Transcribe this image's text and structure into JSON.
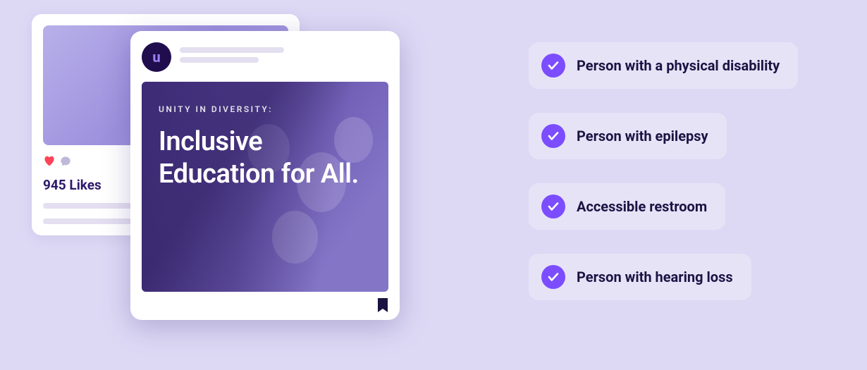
{
  "colors": {
    "background": "#ddd9f5",
    "chip_bg": "#e7e3f7",
    "accent": "#7b4dff",
    "text_dark": "#1a1443",
    "avatar_bg": "#1f0d4d",
    "heart": "#ff4458"
  },
  "back_card": {
    "likes_label": "945 Likes"
  },
  "front_card": {
    "avatar_letter": "u",
    "eyebrow": "UNITY IN DIVERSITY:",
    "headline": "Inclusive Education for All."
  },
  "chips": [
    {
      "label": "Person with a physical disability"
    },
    {
      "label": "Person with epilepsy"
    },
    {
      "label": "Accessible restroom"
    },
    {
      "label": "Person with hearing loss"
    }
  ]
}
